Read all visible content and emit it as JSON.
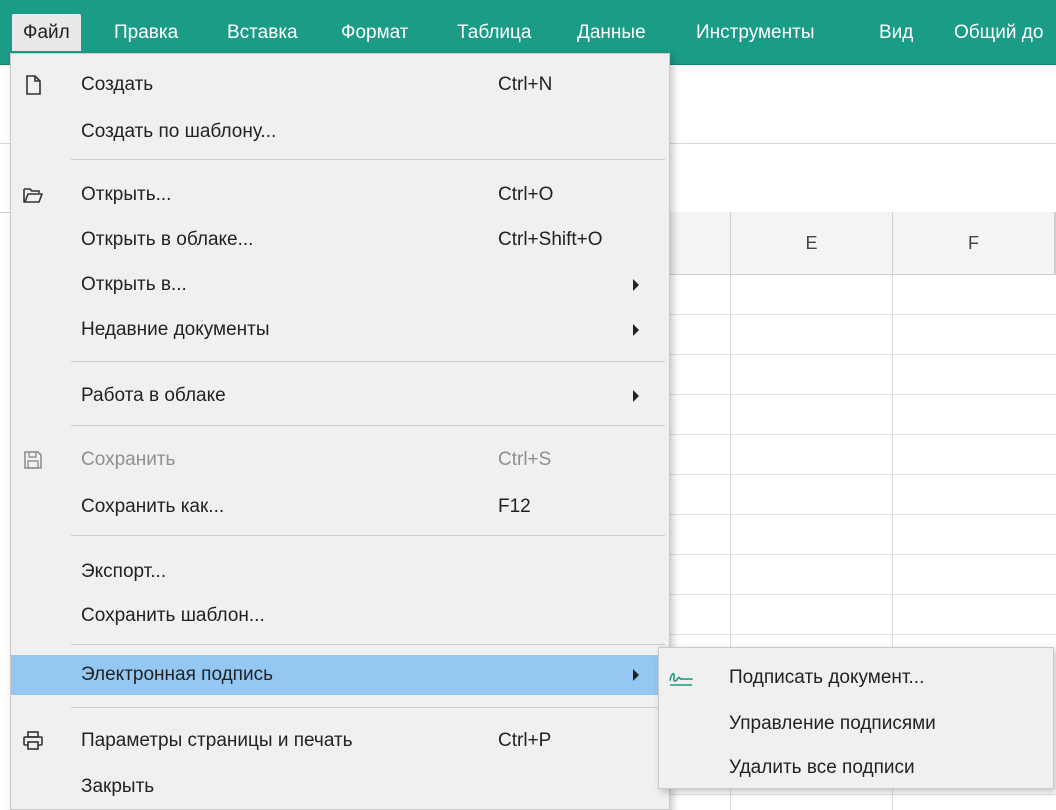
{
  "menubar": {
    "items": [
      {
        "label": "Файл"
      },
      {
        "label": "Правка"
      },
      {
        "label": "Вставка"
      },
      {
        "label": "Формат"
      },
      {
        "label": "Таблица"
      },
      {
        "label": "Данные"
      },
      {
        "label": "Инструменты"
      },
      {
        "label": "Вид"
      },
      {
        "label": "Общий до"
      }
    ],
    "active_index": 0
  },
  "sheet": {
    "columns": [
      {
        "label": ""
      },
      {
        "label": "E"
      },
      {
        "label": "F"
      },
      {
        "label": ""
      }
    ]
  },
  "file_menu": {
    "items": [
      {
        "label": "Создать",
        "shortcut": "Ctrl+N",
        "icon": "new-document-icon"
      },
      {
        "label": "Создать по шаблону...",
        "shortcut": ""
      },
      {
        "label": "Открыть...",
        "shortcut": "Ctrl+O",
        "icon": "open-folder-icon"
      },
      {
        "label": "Открыть в облаке...",
        "shortcut": "Ctrl+Shift+O"
      },
      {
        "label": "Открыть в...",
        "submenu": true
      },
      {
        "label": "Недавние документы",
        "submenu": true
      },
      {
        "label": "Работа в облаке",
        "submenu": true
      },
      {
        "label": "Сохранить",
        "shortcut": "Ctrl+S",
        "icon": "save-disk-icon",
        "disabled": true
      },
      {
        "label": "Сохранить как...",
        "shortcut": "F12"
      },
      {
        "label": "Экспорт...",
        "shortcut": ""
      },
      {
        "label": "Сохранить шаблон...",
        "shortcut": ""
      },
      {
        "label": "Электронная подпись",
        "submenu": true,
        "highlighted": true
      },
      {
        "label": "Параметры страницы и печать",
        "shortcut": "Ctrl+P",
        "icon": "printer-icon"
      },
      {
        "label": "Закрыть",
        "shortcut": ""
      }
    ]
  },
  "signature_submenu": {
    "items": [
      {
        "label": "Подписать документ...",
        "icon": "signature-icon"
      },
      {
        "label": "Управление подписями"
      },
      {
        "label": "Удалить все подписи"
      }
    ]
  },
  "colors": {
    "menubar_bg": "#1b9c86",
    "highlight": "#94c8f3",
    "menu_bg": "#f0f0f0",
    "signature_icon": "#1b9c86"
  }
}
